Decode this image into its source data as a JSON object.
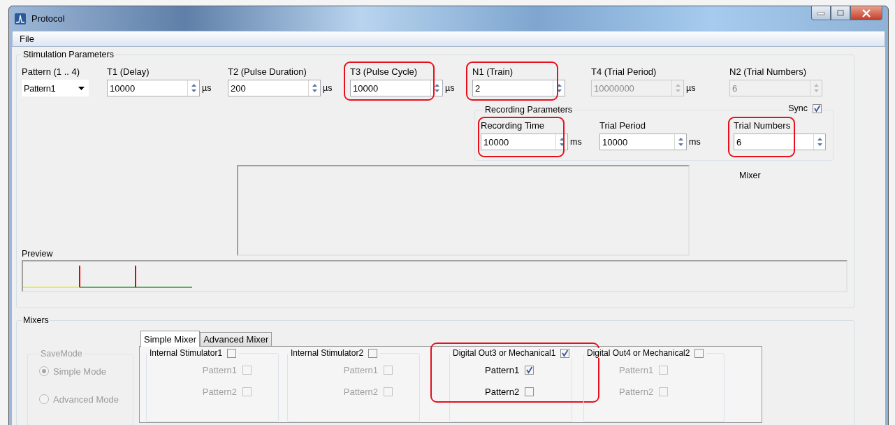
{
  "window": {
    "title": "Protocol"
  },
  "menu": [
    {
      "label": "File"
    }
  ],
  "stimulation": {
    "title": "Stimulation Parameters",
    "pattern": {
      "label": "Pattern (1 .. 4)",
      "value": "Pattern1"
    },
    "fields": [
      {
        "label": "T1 (Delay)",
        "value": "10000",
        "unit": "µs",
        "disabled": false,
        "highlighted": false
      },
      {
        "label": "T2 (Pulse Duration)",
        "value": "200",
        "unit": "µs",
        "disabled": false,
        "highlighted": false
      },
      {
        "label": "T3 (Pulse Cycle)",
        "value": "10000",
        "unit": "µs",
        "disabled": false,
        "highlighted": true
      },
      {
        "label": "N1 (Train)",
        "value": "2",
        "disabled": false,
        "highlighted": true
      },
      {
        "label": "T4 (Trial Period)",
        "value": "10000000",
        "unit": "µs",
        "disabled": true,
        "highlighted": false
      },
      {
        "label": "N2 (Trial Numbers)",
        "value": "6",
        "disabled": true,
        "highlighted": false
      }
    ],
    "recording": {
      "title": "Recording Parameters",
      "sync": {
        "label": "Sync",
        "checked": true
      },
      "fields": [
        {
          "label": "Recording Time",
          "value": "10000",
          "unit": "ms",
          "highlighted": true
        },
        {
          "label": "Trial Period",
          "value": "10000",
          "unit": "ms",
          "highlighted": false
        },
        {
          "label": "Trial Numbers",
          "value": "6",
          "highlighted": true
        }
      ]
    },
    "mixer_label": "Mixer",
    "preview": {
      "label": "Preview"
    }
  },
  "mixers": {
    "title": "Mixers",
    "save_mode": {
      "title": "SaveMode",
      "disabled": true,
      "options": [
        {
          "label": "Simple Mode",
          "selected": true
        },
        {
          "label": "Advanced Mode",
          "selected": false
        }
      ]
    },
    "tabs": [
      {
        "label": "Simple Mixer",
        "selected": true
      },
      {
        "label": "Advanced Mixer",
        "selected": false
      }
    ],
    "groups": [
      {
        "title": "Internal Stimulator1",
        "checked": false,
        "highlighted": false,
        "patterns": [
          {
            "label": "Pattern1",
            "checked": false
          },
          {
            "label": "Pattern2",
            "checked": false
          }
        ]
      },
      {
        "title": "Internal Stimulator2",
        "checked": false,
        "highlighted": false,
        "patterns": [
          {
            "label": "Pattern1",
            "checked": false
          },
          {
            "label": "Pattern2",
            "checked": false
          }
        ]
      },
      {
        "title": "Digital Out3 or Mechanical1",
        "checked": true,
        "highlighted": true,
        "patterns": [
          {
            "label": "Pattern1",
            "checked": true
          },
          {
            "label": "Pattern2",
            "checked": false
          }
        ]
      },
      {
        "title": "Digital Out4 or Mechanical2",
        "checked": false,
        "highlighted": false,
        "patterns": [
          {
            "label": "Pattern1",
            "checked": false
          },
          {
            "label": "Pattern2",
            "checked": false
          }
        ]
      }
    ]
  }
}
